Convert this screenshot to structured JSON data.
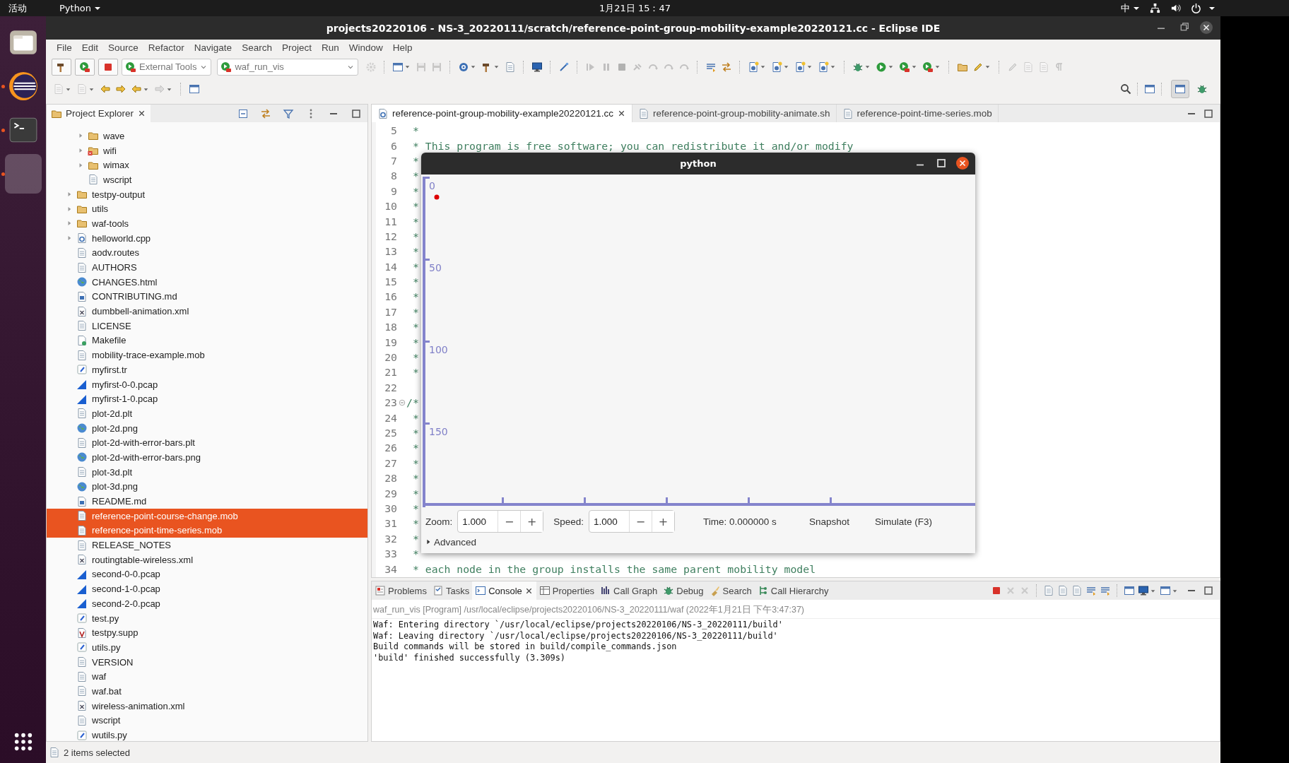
{
  "topbar": {
    "activities": "活动",
    "app_menu": "Python",
    "clock": "1月21日 15：47",
    "input_method": "中"
  },
  "dock": [
    {
      "selected": false,
      "running": false
    },
    {
      "selected": false,
      "running": true
    },
    {
      "selected": false,
      "running": true
    },
    {
      "selected": true,
      "running": true
    }
  ],
  "window": {
    "title": "projects20220106 - NS-3_20220111/scratch/reference-point-group-mobility-example20220121.cc - Eclipse IDE"
  },
  "menu": [
    "File",
    "Edit",
    "Source",
    "Refactor",
    "Navigate",
    "Search",
    "Project",
    "Run",
    "Window",
    "Help"
  ],
  "toolbar": {
    "row1": [
      {
        "kind": "boxed",
        "disabled": false
      },
      {
        "kind": "boxed",
        "disabled": false
      },
      {
        "kind": "boxed",
        "disabled": false
      },
      {
        "kind": "combo",
        "value": "External Tools"
      },
      {
        "kind": "combo",
        "value": "waf_run_vis"
      },
      {
        "kind": "button",
        "disabled": true
      },
      {
        "kind": "separator"
      },
      {
        "kind": "split",
        "disabled": false
      },
      {
        "kind": "button",
        "disabled": true
      },
      {
        "kind": "button",
        "disabled": true
      },
      {
        "kind": "separator"
      },
      {
        "kind": "split",
        "disabled": false
      },
      {
        "kind": "split",
        "disabled": false
      },
      {
        "kind": "button",
        "disabled": false
      },
      {
        "kind": "separator"
      },
      {
        "kind": "button",
        "disabled": false
      },
      {
        "kind": "separator"
      },
      {
        "kind": "button",
        "disabled": false
      },
      {
        "kind": "separator"
      },
      {
        "kind": "button",
        "disabled": true
      },
      {
        "kind": "button",
        "disabled": true
      },
      {
        "kind": "button",
        "disabled": true
      },
      {
        "kind": "button",
        "disabled": true
      },
      {
        "kind": "button",
        "disabled": true
      },
      {
        "kind": "button",
        "disabled": true
      },
      {
        "kind": "button",
        "disabled": true
      },
      {
        "kind": "separator"
      },
      {
        "kind": "button",
        "disabled": false
      },
      {
        "kind": "button",
        "disabled": false
      },
      {
        "kind": "separator"
      },
      {
        "kind": "split",
        "disabled": false
      },
      {
        "kind": "split",
        "disabled": false
      },
      {
        "kind": "split",
        "disabled": false
      },
      {
        "kind": "split",
        "disabled": false
      },
      {
        "kind": "separator"
      },
      {
        "kind": "split",
        "disabled": false
      },
      {
        "kind": "split",
        "disabled": false
      },
      {
        "kind": "split",
        "disabled": false
      },
      {
        "kind": "split",
        "disabled": false
      },
      {
        "kind": "separator"
      },
      {
        "kind": "button",
        "disabled": false
      },
      {
        "kind": "split",
        "disabled": false
      },
      {
        "kind": "separator"
      },
      {
        "kind": "button",
        "disabled": true
      },
      {
        "kind": "button",
        "disabled": true
      },
      {
        "kind": "button",
        "disabled": true
      },
      {
        "kind": "button",
        "disabled": true
      }
    ],
    "row2": [
      {
        "kind": "split",
        "disabled": true
      },
      {
        "kind": "split",
        "disabled": true
      },
      {
        "kind": "button",
        "disabled": false
      },
      {
        "kind": "button",
        "disabled": false
      },
      {
        "kind": "split",
        "disabled": false
      },
      {
        "kind": "split",
        "disabled": true
      },
      {
        "kind": "separator"
      },
      {
        "kind": "button",
        "disabled": false
      }
    ],
    "perspectives": [
      {
        "selected": true
      },
      {
        "selected": false
      }
    ]
  },
  "explorer": {
    "title": "Project Explorer",
    "tree": [
      {
        "children": [
          {
            "label": "wave",
            "kind": "folder",
            "expanded": false,
            "selected": false
          },
          {
            "label": "wifi",
            "kind": "folder-error",
            "expanded": false,
            "selected": false
          },
          {
            "label": "wimax",
            "kind": "folder",
            "expanded": false,
            "selected": false
          },
          {
            "label": "wscript",
            "kind": "file",
            "selected": false
          }
        ]
      },
      {
        "label": "testpy-output",
        "kind": "folder",
        "expanded": false,
        "selected": false
      },
      {
        "label": "utils",
        "kind": "folder",
        "expanded": false,
        "selected": false
      },
      {
        "label": "waf-tools",
        "kind": "folder",
        "expanded": false,
        "selected": false
      },
      {
        "label": "helloworld.cpp",
        "kind": "cfile",
        "expanded": false,
        "selected": false
      },
      {
        "label": "aodv.routes",
        "kind": "file",
        "selected": false
      },
      {
        "label": "AUTHORS",
        "kind": "file",
        "selected": false
      },
      {
        "label": "CHANGES.html",
        "kind": "globe",
        "selected": false
      },
      {
        "label": "CONTRIBUTING.md",
        "kind": "word",
        "selected": false
      },
      {
        "label": "dumbbell-animation.xml",
        "kind": "xml",
        "selected": false
      },
      {
        "label": "LICENSE",
        "kind": "file",
        "selected": false
      },
      {
        "label": "Makefile",
        "kind": "makefile",
        "selected": false
      },
      {
        "label": "mobility-trace-example.mob",
        "kind": "file",
        "selected": false
      },
      {
        "label": "myfirst.tr",
        "kind": "script",
        "selected": false
      },
      {
        "label": "myfirst-0-0.pcap",
        "kind": "pcap",
        "selected": false
      },
      {
        "label": "myfirst-1-0.pcap",
        "kind": "pcap",
        "selected": false
      },
      {
        "label": "plot-2d.plt",
        "kind": "file",
        "selected": false
      },
      {
        "label": "plot-2d.png",
        "kind": "globe",
        "selected": false
      },
      {
        "label": "plot-2d-with-error-bars.plt",
        "kind": "file",
        "selected": false
      },
      {
        "label": "plot-2d-with-error-bars.png",
        "kind": "globe",
        "selected": false
      },
      {
        "label": "plot-3d.plt",
        "kind": "file",
        "selected": false
      },
      {
        "label": "plot-3d.png",
        "kind": "globe",
        "selected": false
      },
      {
        "label": "README.md",
        "kind": "word",
        "selected": false
      },
      {
        "label": "reference-point-course-change.mob",
        "kind": "file",
        "selected": true
      },
      {
        "label": "reference-point-time-series.mob",
        "kind": "file",
        "selected": true
      },
      {
        "label": "RELEASE_NOTES",
        "kind": "file",
        "selected": false
      },
      {
        "label": "routingtable-wireless.xml",
        "kind": "xml",
        "selected": false
      },
      {
        "label": "second-0-0.pcap",
        "kind": "pcap",
        "selected": false
      },
      {
        "label": "second-1-0.pcap",
        "kind": "pcap",
        "selected": false
      },
      {
        "label": "second-2-0.pcap",
        "kind": "pcap",
        "selected": false
      },
      {
        "label": "test.py",
        "kind": "script",
        "selected": false
      },
      {
        "label": "testpy.supp",
        "kind": "valgrind",
        "selected": false
      },
      {
        "label": "utils.py",
        "kind": "script",
        "selected": false
      },
      {
        "label": "VERSION",
        "kind": "file",
        "selected": false
      },
      {
        "label": "waf",
        "kind": "file",
        "selected": false
      },
      {
        "label": "waf.bat",
        "kind": "file",
        "selected": false
      },
      {
        "label": "wireless-animation.xml",
        "kind": "xml",
        "selected": false
      },
      {
        "label": "wscript",
        "kind": "file",
        "selected": false
      },
      {
        "label": "wutils.py",
        "kind": "script",
        "selected": false
      }
    ]
  },
  "editor": {
    "tabs": [
      {
        "label": "reference-point-group-mobility-example20220121.cc",
        "kind": "cfile",
        "selected": true
      },
      {
        "label": "reference-point-group-mobility-animate.sh",
        "kind": "file",
        "selected": false
      },
      {
        "label": "reference-point-time-series.mob",
        "kind": "file",
        "selected": false
      }
    ],
    "lines": [
      {
        "number": "5",
        "text": " *"
      },
      {
        "number": "6",
        "text": " * This program is free software; you can redistribute it and/or modify"
      },
      {
        "number": "7",
        "text": " *"
      },
      {
        "number": "8",
        "text": " *"
      },
      {
        "number": "9",
        "text": " *"
      },
      {
        "number": "10",
        "text": " *"
      },
      {
        "number": "11",
        "text": " *"
      },
      {
        "number": "12",
        "text": " *"
      },
      {
        "number": "13",
        "text": " *"
      },
      {
        "number": "14",
        "text": " *"
      },
      {
        "number": "15",
        "text": " *"
      },
      {
        "number": "16",
        "text": " *"
      },
      {
        "number": "17",
        "text": " *"
      },
      {
        "number": "18",
        "text": " *"
      },
      {
        "number": "19",
        "text": " *"
      },
      {
        "number": "20",
        "text": " *"
      },
      {
        "number": "21",
        "text": " *"
      },
      {
        "number": "22"
      },
      {
        "number": "23",
        "text": "/*",
        "expanded": true
      },
      {
        "number": "24",
        "text": " *"
      },
      {
        "number": "25",
        "text": " *"
      },
      {
        "number": "26",
        "text": " *"
      },
      {
        "number": "27",
        "text": " *"
      },
      {
        "number": "28",
        "text": " *"
      },
      {
        "number": "29",
        "text": " *"
      },
      {
        "number": "30",
        "text": " *"
      },
      {
        "number": "31",
        "text": " *"
      },
      {
        "number": "32",
        "text": " *"
      },
      {
        "number": "33",
        "text": " *"
      },
      {
        "number": "34",
        "text": " * each node in the group installs the same parent mobility model"
      }
    ]
  },
  "python_window": {
    "title": "python",
    "y_labels": [
      "0",
      "50",
      "100",
      "150"
    ],
    "zoom": {
      "label": "Zoom:",
      "value": "1.000",
      "decrement": "−",
      "increment": "+"
    },
    "speed": {
      "label": "Speed:",
      "value": "1.000",
      "decrement": "−",
      "increment": "+"
    },
    "time": "Time: 0.000000 s",
    "buttons": [
      "Snapshot",
      "Simulate (F3)"
    ],
    "advanced": {
      "label": "Advanced",
      "expanded": false
    }
  },
  "bottom_panel": {
    "tabs": [
      {
        "label": "Problems",
        "selected": false
      },
      {
        "label": "Tasks",
        "selected": false
      },
      {
        "label": "Console",
        "selected": true
      },
      {
        "label": "Properties",
        "selected": false
      },
      {
        "label": "Call Graph",
        "selected": false
      },
      {
        "label": "Debug",
        "selected": false
      },
      {
        "label": "Search",
        "selected": false
      },
      {
        "label": "Call Hierarchy",
        "selected": false
      }
    ],
    "toolbar": [
      {
        "kind": "button",
        "disabled": false
      },
      {
        "kind": "button",
        "disabled": true
      },
      {
        "kind": "button",
        "disabled": true
      },
      {
        "kind": "separator"
      },
      {
        "kind": "button",
        "disabled": false
      },
      {
        "kind": "button",
        "disabled": false
      },
      {
        "kind": "button",
        "disabled": false
      },
      {
        "kind": "button",
        "disabled": false
      },
      {
        "kind": "button",
        "disabled": false
      },
      {
        "kind": "separator"
      },
      {
        "kind": "button",
        "disabled": false
      },
      {
        "kind": "split",
        "disabled": false
      },
      {
        "kind": "split",
        "disabled": false
      }
    ],
    "console_title": "waf_run_vis [Program] /usr/local/eclipse/projects20220106/NS-3_20220111/waf (2022年1月21日 下午3:47:37)",
    "output": [
      "Waf: Entering directory `/usr/local/eclipse/projects20220106/NS-3_20220111/build'",
      "Waf: Leaving directory `/usr/local/eclipse/projects20220106/NS-3_20220111/build'",
      "Build commands will be stored in build/compile_commands.json",
      "'build' finished successfully (3.309s)"
    ]
  },
  "status_bar": "2 items selected"
}
